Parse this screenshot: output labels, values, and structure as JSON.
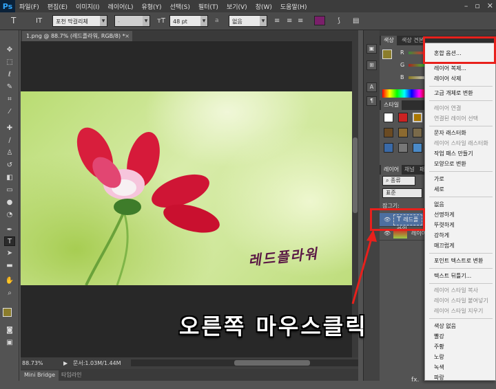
{
  "app": {
    "logo": "Ps"
  },
  "menubar": {
    "items": [
      "파일(F)",
      "편집(E)",
      "이미지(I)",
      "레이어(L)",
      "유형(Y)",
      "선택(S)",
      "필터(T)",
      "보기(V)",
      "창(W)",
      "도움말(H)"
    ]
  },
  "options_bar": {
    "font_family": "포천 막걸리체",
    "font_style": "-",
    "font_size": "48 pt",
    "anti_alias_label": "a",
    "anti_alias": "없음",
    "text_color": "#7a1f6a"
  },
  "document": {
    "tab_title": "1.png @ 88.7% (레드플라워, RGB/8) *",
    "close": "×",
    "overlay_text": "레드플라워"
  },
  "status": {
    "zoom": "88.73%",
    "doc_info": "문서:1.03M/1.44M",
    "bottom_tabs": [
      "Mini Bridge",
      "타임라인"
    ]
  },
  "panels": {
    "color_tabs": [
      "색상",
      "색상 견본"
    ],
    "slider_labels": [
      "R",
      "G",
      "B"
    ],
    "foreground_color": "#8b7d2c",
    "styles_tab": "스타일",
    "layers_tabs": [
      "레이어",
      "채널",
      "패스"
    ],
    "filter_kind": "종류",
    "blend_mode": "표준",
    "lock_label": "잠그기:",
    "layer_rows": [
      {
        "name": "레드플라워",
        "type": "text"
      },
      {
        "name": "레이어",
        "type": "image"
      }
    ],
    "fx_label": "fx."
  },
  "context_menu": {
    "items": [
      {
        "label": "혼합 옵션...",
        "enabled": true
      },
      {
        "label": "레이어 복제...",
        "enabled": true
      },
      {
        "label": "레이어 삭제",
        "enabled": true
      },
      {
        "label": "고급 개체로 변환",
        "enabled": true
      },
      {
        "label": "레이어 연결",
        "enabled": false
      },
      {
        "label": "연결된 레이어 선택",
        "enabled": false
      },
      {
        "label": "문자 래스터화",
        "enabled": true
      },
      {
        "label": "레이어 스타일 래스터화",
        "enabled": false
      },
      {
        "label": "작업 패스 만들기",
        "enabled": true
      },
      {
        "label": "모양으로 변환",
        "enabled": true
      },
      {
        "label": "가로",
        "enabled": true
      },
      {
        "label": "세로",
        "enabled": true
      },
      {
        "label": "없음",
        "enabled": true
      },
      {
        "label": "선명하게",
        "enabled": true
      },
      {
        "label": "뚜렷하게",
        "enabled": true
      },
      {
        "label": "강하게",
        "enabled": true
      },
      {
        "label": "매끄럽게",
        "enabled": true
      },
      {
        "label": "포인트 텍스트로 변환",
        "enabled": true
      },
      {
        "label": "텍스트 뒤틀기...",
        "enabled": true
      },
      {
        "label": "레이어 스타일 복사",
        "enabled": false
      },
      {
        "label": "레이어 스타일 붙여넣기",
        "enabled": false
      },
      {
        "label": "레이어 스타일 지우기",
        "enabled": false
      },
      {
        "label": "색상 없음",
        "enabled": true
      },
      {
        "label": "빨강",
        "enabled": true
      },
      {
        "label": "주황",
        "enabled": true
      },
      {
        "label": "노랑",
        "enabled": true
      },
      {
        "label": "녹색",
        "enabled": true
      },
      {
        "label": "파랑",
        "enabled": true
      }
    ]
  },
  "annotation": {
    "caption": "오른쪽 마우스클릭",
    "color": "#e8201c"
  }
}
